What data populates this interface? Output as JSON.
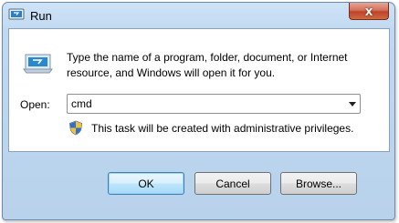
{
  "window": {
    "title": "Run",
    "close_glyph": "x"
  },
  "dialog": {
    "instructions": "Type the name of a program, folder, document, or Internet resource, and Windows will open it for you.",
    "open_label": "Open:",
    "open_value": "cmd",
    "admin_note": "This task will be created with administrative privileges."
  },
  "buttons": {
    "ok": "OK",
    "cancel": "Cancel",
    "browse": "Browse..."
  },
  "icons": {
    "app": "run-app-icon",
    "dialog": "run-dialog-icon",
    "shield": "uac-shield-icon",
    "dropdown": "chevron-down-icon"
  }
}
